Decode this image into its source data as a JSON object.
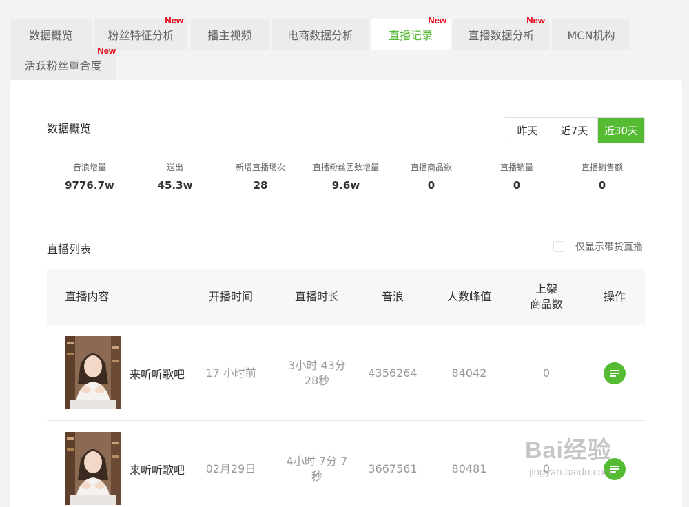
{
  "tabs": [
    {
      "label": "数据概览",
      "badge": ""
    },
    {
      "label": "粉丝特征分析",
      "badge": "New"
    },
    {
      "label": "播主视频",
      "badge": ""
    },
    {
      "label": "电商数据分析",
      "badge": ""
    },
    {
      "label": "直播记录",
      "badge": "New"
    },
    {
      "label": "直播数据分析",
      "badge": "New"
    },
    {
      "label": "MCN机构",
      "badge": ""
    },
    {
      "label": "活跃粉丝重合度",
      "badge": "New"
    }
  ],
  "overview": {
    "title": "数据概览",
    "ranges": [
      "昨天",
      "近7天",
      "近30天"
    ],
    "active_range": "近30天",
    "stats": [
      {
        "label": "音浪增量",
        "value": "9776.7w"
      },
      {
        "label": "送出",
        "value": "45.3w"
      },
      {
        "label": "新增直播场次",
        "value": "28"
      },
      {
        "label": "直播粉丝团数增量",
        "value": "9.6w"
      },
      {
        "label": "直播商品数",
        "value": "0"
      },
      {
        "label": "直播销量",
        "value": "0"
      },
      {
        "label": "直播销售额",
        "value": "0"
      }
    ]
  },
  "live_list": {
    "title": "直播列表",
    "filter_label": "仅显示带货直播",
    "columns": [
      "直播内容",
      "开播时间",
      "直播时长",
      "音浪",
      "人数峰值",
      "上架\n商品数",
      "操作"
    ],
    "rows": [
      {
        "title": "来听听歌吧",
        "start": "17 小时前",
        "duration": "3小时 43分 28秒",
        "yinlang": "4356264",
        "peak": "84042",
        "goods": "0"
      },
      {
        "title": "来听听歌吧",
        "start": "02月29日",
        "duration": "4小时 7分 7 秒",
        "yinlang": "3667561",
        "peak": "80481",
        "goods": "0"
      }
    ]
  },
  "watermark": {
    "main": "Bai经验",
    "sub": "jingyan.baidu.com"
  },
  "colors": {
    "accent": "#55bb33",
    "badge": "#e60012"
  }
}
